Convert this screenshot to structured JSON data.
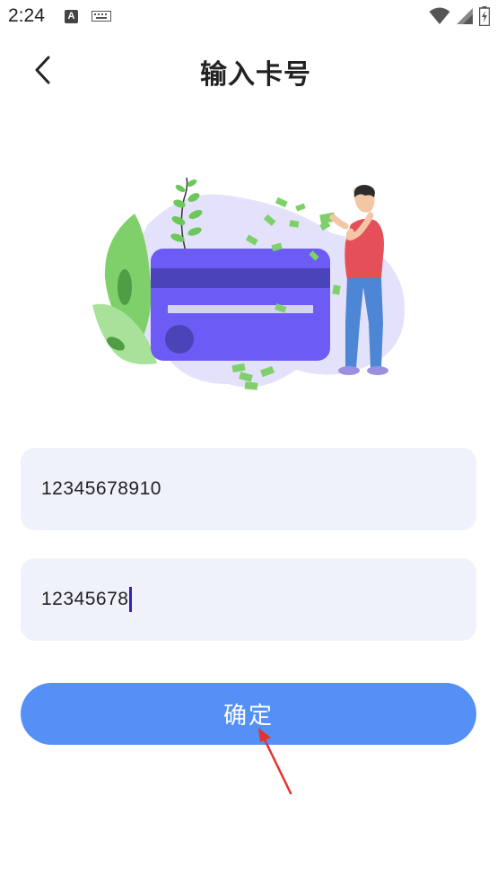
{
  "status_bar": {
    "time": "2:24",
    "a_icon_letter": "A",
    "icons": [
      "a-notification-icon",
      "keyboard-icon",
      "wifi-icon",
      "signal-icon",
      "battery-icon"
    ]
  },
  "header": {
    "title": "输入卡号",
    "back_icon": "chevron-left-icon"
  },
  "form": {
    "card_number_value": "12345678910",
    "second_field_value": "12345678"
  },
  "confirm_button": {
    "label": "确定",
    "color": "#5590f7"
  },
  "colors": {
    "input_background": "#f0f2fb",
    "card_purple": "#6c5cf5",
    "annotation_arrow": "#e5322d"
  }
}
